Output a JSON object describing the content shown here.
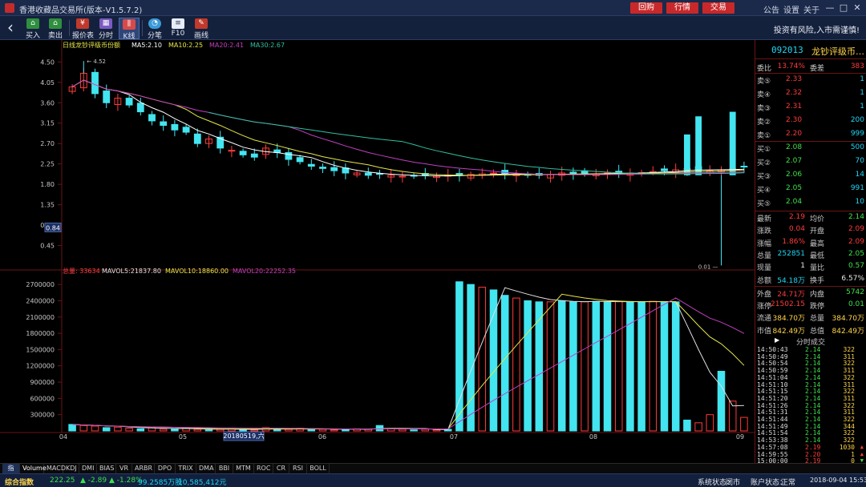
{
  "window": {
    "title": "香港收藏品交易所(版本-V1.5.7.2)",
    "top_buttons": [
      "回购",
      "行情",
      "交易"
    ],
    "top_links": [
      "公告",
      "设置",
      "关于"
    ],
    "controls": [
      "—",
      "□",
      "✕"
    ]
  },
  "toolbar": {
    "items": [
      {
        "label": "买入",
        "icon": "buy-icon",
        "color": "#2f8f3f"
      },
      {
        "label": "卖出",
        "icon": "sell-icon",
        "color": "#2f8f3f"
      },
      {
        "label": "报价表",
        "icon": "quote-table-icon",
        "color": "#c0392b"
      },
      {
        "label": "分时",
        "icon": "timeshare-icon",
        "color": "#7a5ac2"
      },
      {
        "label": "K线",
        "icon": "kline-icon",
        "color": "#d64a4a"
      },
      {
        "label": "分笔",
        "icon": "tick-icon",
        "color": "#3c9ad8"
      },
      {
        "label": "F10",
        "icon": "f10-icon",
        "color": "#8fb0e6"
      },
      {
        "label": "画线",
        "icon": "draw-line-icon",
        "color": "#c0392b"
      }
    ],
    "risk_notice": "投资有风险,入市需谨慎!"
  },
  "chart": {
    "legend_prefix": "日线",
    "product": "龙钞评级币份额",
    "ma_labels": [
      "MA5:2.10",
      "MA10:2.25",
      "MA20:2.41",
      "MA30:2.67"
    ],
    "ma_colors": [
      "#ffffff",
      "#e6e64a",
      "#c040c0",
      "#30c0a0"
    ],
    "high_marker": "4.52",
    "low_marker": "0.01",
    "cursor_price": "0.84",
    "cursor_date": "20180519,六",
    "vol_legend": [
      "总量: 33634",
      "MAVOL5:21837.80",
      "MAVOL10:18860.00",
      "MAVOL20:22252.35"
    ],
    "vol_legend_colors": [
      "#ff4040",
      "#e0e0e0",
      "#e6e64a",
      "#c040c0"
    ],
    "x_ticks": [
      "04",
      "05",
      "06",
      "07",
      "08",
      "09"
    ]
  },
  "chart_data": [
    {
      "type": "candlestick",
      "title": "日线",
      "y_ticks": [
        4.5,
        4.05,
        3.6,
        3.15,
        2.7,
        2.25,
        1.8,
        1.35,
        0.9,
        0.45
      ],
      "ylim": [
        0.0,
        4.7
      ],
      "x_ticks": [
        "04",
        "05",
        "06",
        "07",
        "08",
        "09"
      ],
      "close_approx": [
        3.95,
        4.25,
        3.8,
        3.6,
        3.7,
        3.55,
        3.4,
        3.2,
        3.1,
        3.0,
        2.95,
        2.7,
        2.8,
        2.6,
        2.55,
        2.45,
        2.4,
        2.6,
        2.5,
        2.35,
        2.3,
        2.2,
        2.15,
        2.1,
        2.05,
        2.05,
        2.0,
        2.02,
        2.0,
        1.98,
        1.98,
        1.99,
        1.98,
        2.0,
        2.0,
        2.02,
        2.03,
        2.05,
        2.03,
        2.02,
        2.0,
        2.0,
        2.02,
        2.05,
        2.04,
        2.03,
        2.02,
        2.05,
        2.06,
        2.05,
        2.06,
        2.08,
        2.1,
        2.12,
        2.15,
        2.12,
        2.1,
        2.12,
        2.14,
        2.19
      ],
      "ma_last": {
        "MA5": 2.1,
        "MA10": 2.25,
        "MA20": 2.41,
        "MA30": 2.67
      },
      "high": 4.52,
      "low": 0.01
    },
    {
      "type": "bar",
      "title": "总量",
      "y_ticks": [
        2700000,
        2400000,
        2100000,
        1800000,
        1500000,
        1200000,
        900000,
        600000,
        300000
      ],
      "ylim": [
        0,
        2850000
      ],
      "total_volume": 33634,
      "mavol": {
        "MAVOL5": 21837.8,
        "MAVOL10": 18860.0,
        "MAVOL20": 22252.35
      },
      "note_series": "volume estimates",
      "values_approx": [
        120000,
        100000,
        90000,
        60000,
        70000,
        50000,
        40000,
        60000,
        30000,
        40000,
        50000,
        30000,
        20000,
        30000,
        40000,
        30000,
        20000,
        60000,
        40000,
        30000,
        50000,
        40000,
        30000,
        20000,
        30000,
        40000,
        30000,
        100000,
        40000,
        30000,
        20000,
        30000,
        20000,
        30000,
        2750000,
        2700000,
        2650000,
        2600000,
        2500000,
        2450000,
        2400000,
        2380000,
        2380000,
        2400000,
        2380000,
        2380000,
        2390000,
        2380000,
        2390000,
        2380000,
        2380000,
        2390000,
        2380000,
        2380000,
        200000,
        150000,
        300000,
        1100000,
        550000,
        250000
      ]
    }
  ],
  "quote": {
    "code": "092013",
    "name": "龙钞评级币…",
    "wei_bi_label": "委比",
    "wei_bi": "13.74%",
    "wei_cha_label": "委差",
    "wei_cha": "383",
    "sell": [
      {
        "label": "卖⑤",
        "price": "2.33",
        "vol": "1"
      },
      {
        "label": "卖④",
        "price": "2.32",
        "vol": "1"
      },
      {
        "label": "卖③",
        "price": "2.31",
        "vol": "1"
      },
      {
        "label": "卖②",
        "price": "2.30",
        "vol": "200"
      },
      {
        "label": "卖①",
        "price": "2.20",
        "vol": "999"
      }
    ],
    "buy": [
      {
        "label": "买①",
        "price": "2.08",
        "vol": "500"
      },
      {
        "label": "买②",
        "price": "2.07",
        "vol": "70"
      },
      {
        "label": "买③",
        "price": "2.06",
        "vol": "14"
      },
      {
        "label": "买④",
        "price": "2.05",
        "vol": "991"
      },
      {
        "label": "买⑤",
        "price": "2.04",
        "vol": "10"
      }
    ],
    "stats": [
      {
        "l1": "最新",
        "v1": "2.19",
        "c1": "red",
        "l2": "均价",
        "v2": "2.14",
        "c2": "green"
      },
      {
        "l1": "涨跌",
        "v1": "0.04",
        "c1": "red",
        "l2": "开盘",
        "v2": "2.09",
        "c2": "red"
      },
      {
        "l1": "涨幅",
        "v1": "1.86%",
        "c1": "red",
        "l2": "最高",
        "v2": "2.09",
        "c2": "red"
      },
      {
        "l1": "总量",
        "v1": "252851",
        "c1": "cyan",
        "l2": "最低",
        "v2": "2.05",
        "c2": "green"
      },
      {
        "l1": "现量",
        "v1": "1",
        "c1": "white",
        "l2": "量比",
        "v2": "0.57",
        "c2": "green"
      },
      {
        "l1": "总额",
        "v1": "54.18万",
        "c1": "cyan",
        "l2": "换手",
        "v2": "6.57%",
        "c2": "white"
      }
    ],
    "stats2": [
      {
        "l1": "外盘",
        "v1": "24.71万",
        "c1": "red",
        "l2": "内盘",
        "v2": "5742",
        "c2": "green"
      },
      {
        "l1": "涨停",
        "v1": "21502.15",
        "c1": "red",
        "l2": "跌停",
        "v2": "0.01",
        "c2": "green"
      },
      {
        "l1": "流通",
        "v1": "384.70万",
        "c1": "yel",
        "l2": "总量",
        "v2": "384.70万",
        "c2": "yel"
      },
      {
        "l1": "市值",
        "v1": "842.49万",
        "c1": "yel",
        "l2": "总值",
        "v2": "842.49万",
        "c2": "yel"
      }
    ],
    "trades_title": "分时成交",
    "trades": [
      {
        "t": "14:50:43",
        "p": "2.14",
        "v": "322",
        "d": ""
      },
      {
        "t": "14:50:49",
        "p": "2.14",
        "v": "311",
        "d": ""
      },
      {
        "t": "14:50:54",
        "p": "2.14",
        "v": "322",
        "d": ""
      },
      {
        "t": "14:50:59",
        "p": "2.14",
        "v": "311",
        "d": ""
      },
      {
        "t": "14:51:04",
        "p": "2.14",
        "v": "322",
        "d": ""
      },
      {
        "t": "14:51:10",
        "p": "2.14",
        "v": "311",
        "d": ""
      },
      {
        "t": "14:51:15",
        "p": "2.14",
        "v": "322",
        "d": ""
      },
      {
        "t": "14:51:20",
        "p": "2.14",
        "v": "311",
        "d": ""
      },
      {
        "t": "14:51:26",
        "p": "2.14",
        "v": "322",
        "d": ""
      },
      {
        "t": "14:51:31",
        "p": "2.14",
        "v": "311",
        "d": ""
      },
      {
        "t": "14:51:44",
        "p": "2.14",
        "v": "322",
        "d": ""
      },
      {
        "t": "14:51:49",
        "p": "2.14",
        "v": "344",
        "d": ""
      },
      {
        "t": "14:51:54",
        "p": "2.14",
        "v": "322",
        "d": ""
      },
      {
        "t": "14:53:38",
        "p": "2.14",
        "v": "322",
        "d": ""
      },
      {
        "t": "14:57:08",
        "p": "2.19",
        "v": "1030",
        "d": "▲"
      },
      {
        "t": "14:59:55",
        "p": "2.20",
        "v": "1",
        "d": "▲"
      },
      {
        "t": "15:00:00",
        "p": "2.19",
        "v": "0",
        "d": "▼"
      }
    ]
  },
  "tabs": [
    "指标",
    "Volume",
    "MACD",
    "KDJ",
    "DMI",
    "BIAS",
    "VR",
    "ARBR",
    "DPO",
    "TRIX",
    "DMA",
    "BBI",
    "MTM",
    "ROC",
    "CR",
    "RSI",
    "BOLL"
  ],
  "statusbar": {
    "index_label": "综合指数",
    "index_value": "222.25",
    "change": "▲ -2.89",
    "change_pct": "▲ -1.28%",
    "volume": "99.2585万股",
    "amount": "10,585,412元",
    "sys_label": "系统状态：",
    "sys_value": "闭市",
    "acct_label": "账户状态：",
    "acct_value": "正常",
    "datetime": "2018-09-04 15:53:27"
  }
}
